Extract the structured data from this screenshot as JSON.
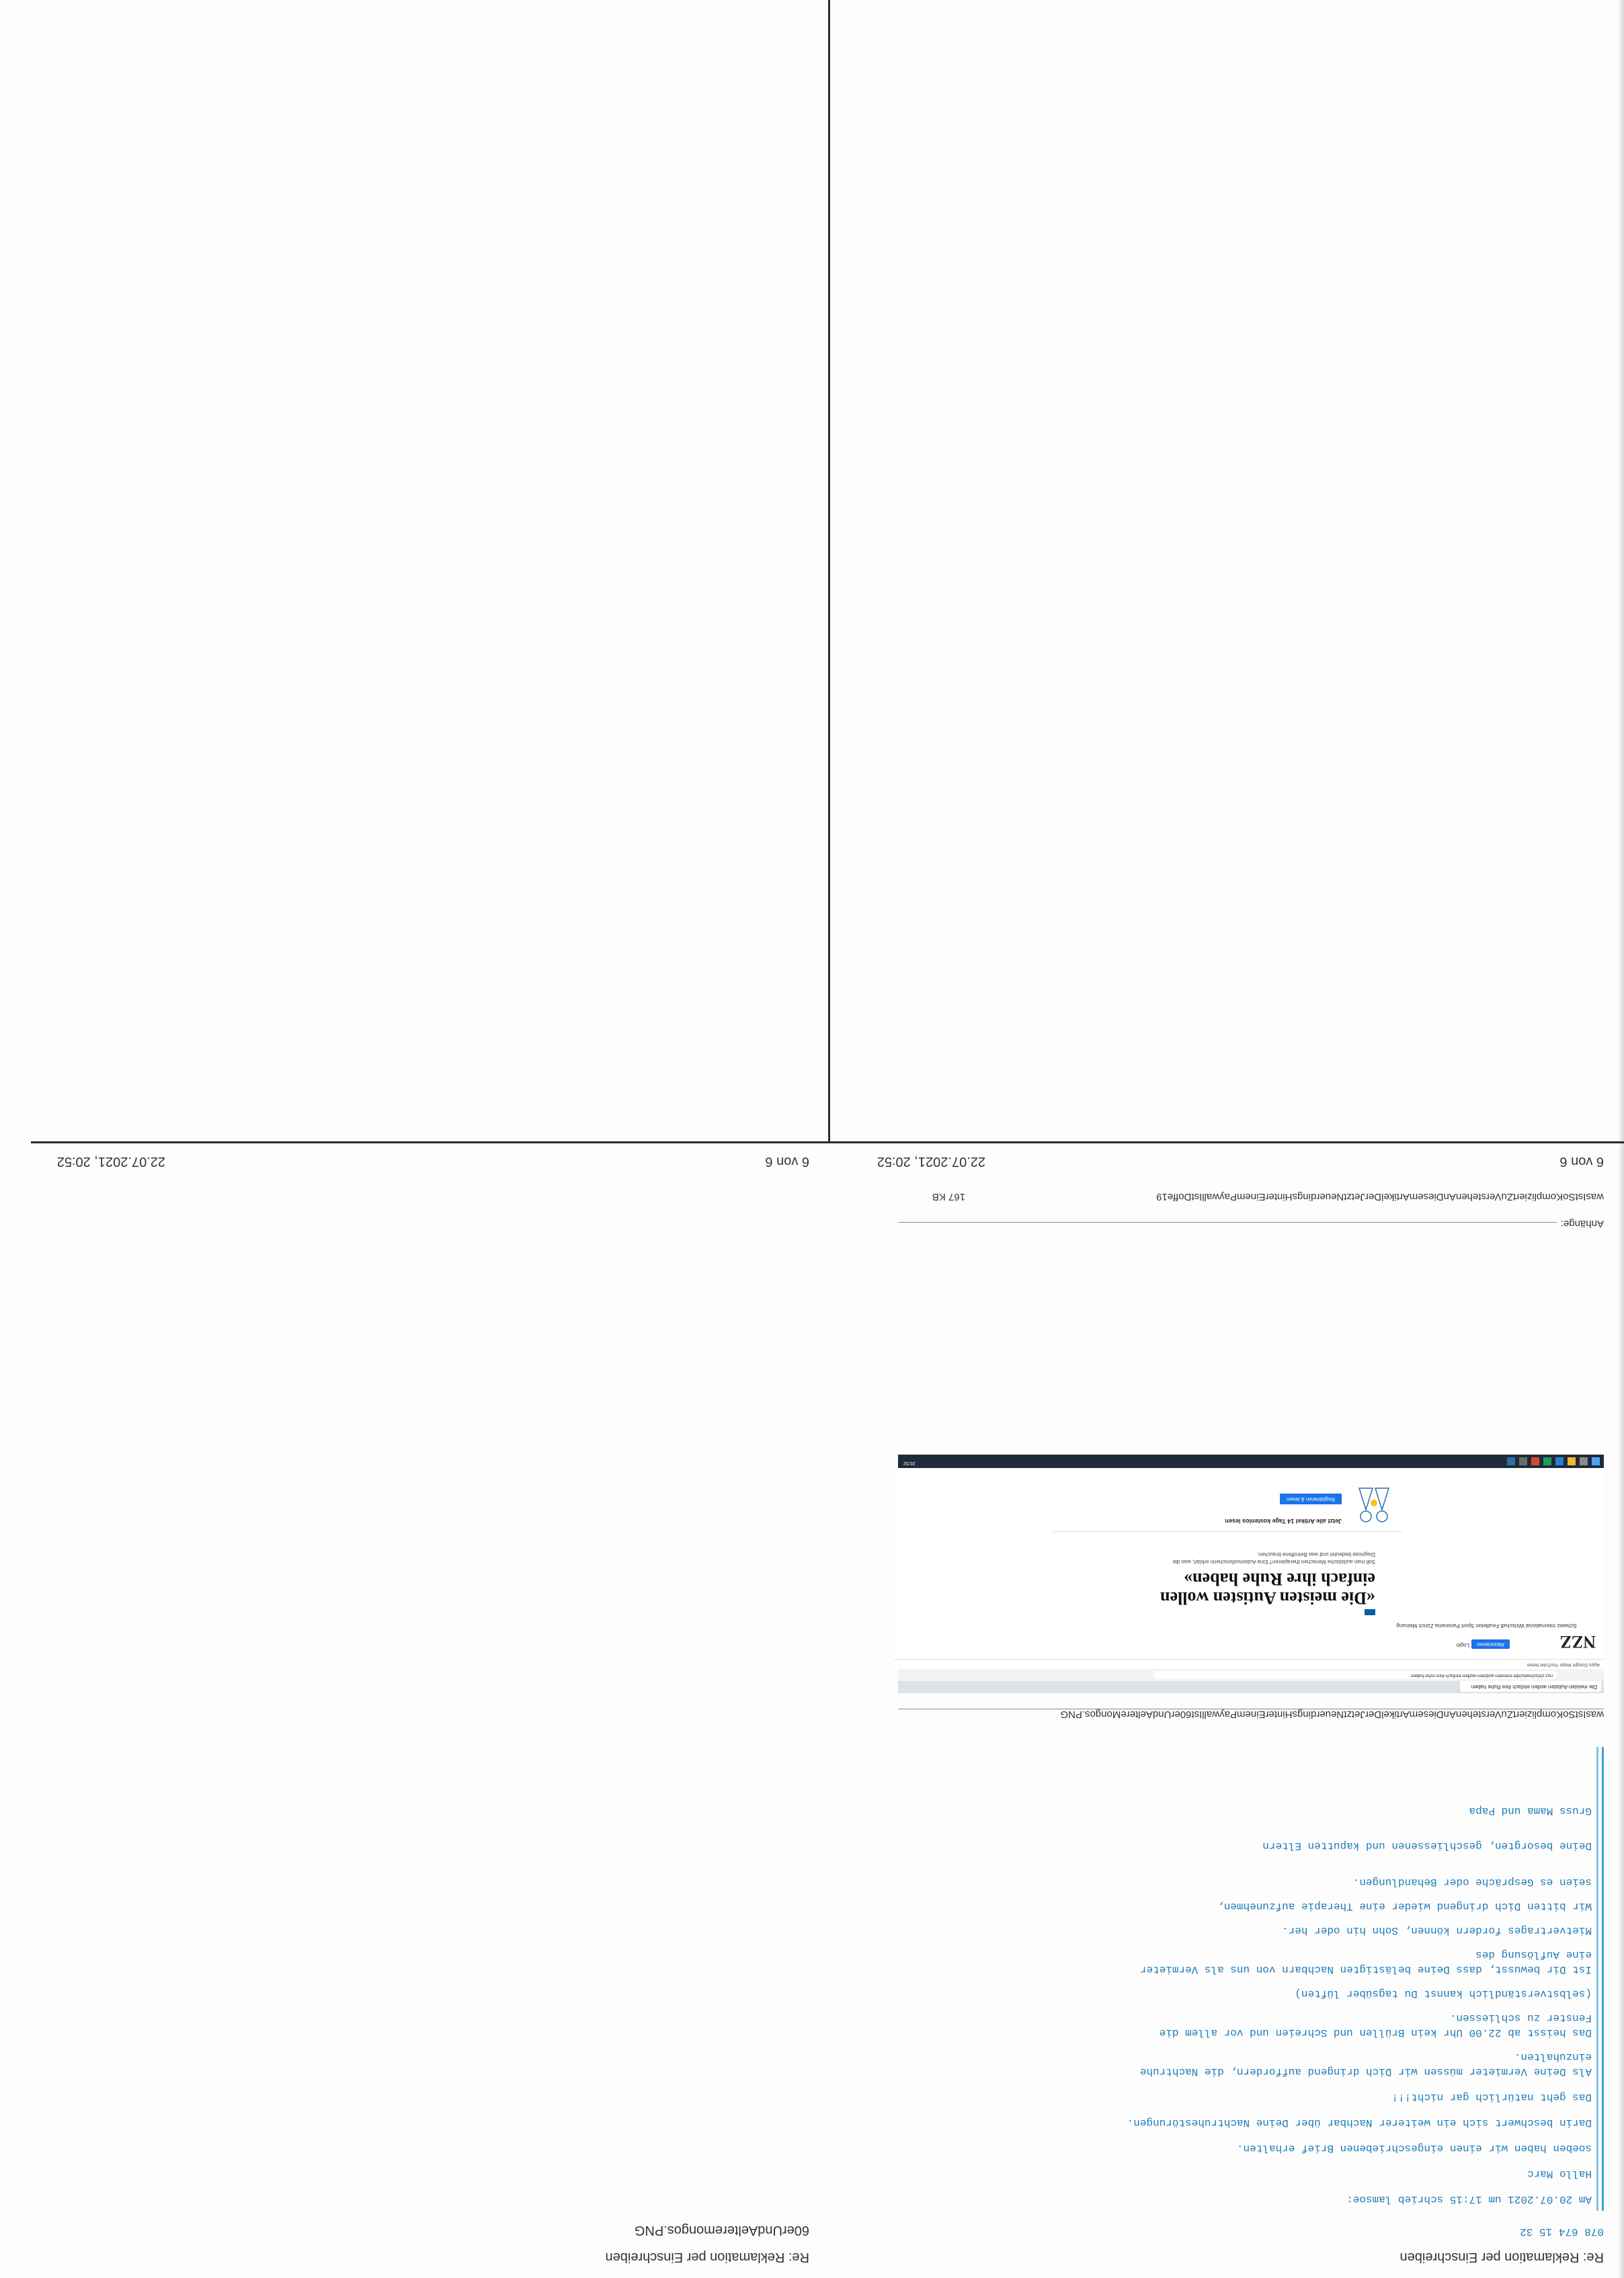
{
  "pages": {
    "right_top": {
      "header_left": "Re: Reklamation per Einschreiben",
      "attachment_name": "60erUndAelteremongos.PNG",
      "footer_page": "6 von 6",
      "footer_date": "22.07.2021, 20:52"
    },
    "left_top": {
      "header_left": "Re: Reklamation per Einschreiben",
      "phone": "078 674 15 32",
      "email_lines": [
        "Am 20.07.2021 um 17:15 schrieb lamsoe:",
        "Hallo Marc",
        "soeben haben wir einen eingeschriebenen Brief erhalten.",
        "Darin beschwert sich ein weiterer Nachbar über Deine Nachtruhestörungen.",
        "Das geht natürlich gar nicht!!!",
        "Als Deine Vermieter müssen wir Dich dringend auffordern, die Nachtruhe",
        "einzuhalten.",
        "Das heisst ab 22.00 Uhr kein Brüllen und Schreien und vor allem die",
        "Fenster zu schliessen.",
        "(selbstverständlich kannst Du tagsüber lüften)",
        "Ist Dir bewusst, dass Deine belästigten Nachbarn von uns als Vermieter",
        "eine Auflösung des",
        "Mietvertrages fordern können, Sohn hin oder her.",
        "Wir bitten Dich dringend  wieder eine Therapie aufzunehmen,",
        "seien es Gespräche oder Behandlungen.",
        "Deine besorgten, geschliessenen und kaputten Eltern",
        "Gruss Mama und Papa"
      ],
      "attachment1_name": "wasIstSoKompliziertZuVerstehenAnDiesemArtikelDerJetztNeuerdingsHinterEinemPaywallIst60erUndAeltereMongos.PNG",
      "attachments_label": "Anhänge:",
      "attachment2_name": "wasIstSoKompliziertZuVerstehenAnDiesemArtikelDerJetztNeuerdingsHinterEinemPaywallIstDoffe19",
      "attachment2_size": "167 KB",
      "footer_page": "6 von 6",
      "footer_date": "22.07.2021, 20:52"
    }
  },
  "screenshot": {
    "tab": "Die meisten Autisten wollen einfach ihre Ruhe haben",
    "url": "nzz.ch/schweiz/die-meisten-autisten-wollen-einfach-ihre-ruhe-haben",
    "bookmarks": "Apps   Google Maps   YouTube   News",
    "logo": "NZZ",
    "abo_button": "Abonnieren",
    "login": "Login",
    "nav": "Schweiz   International   Wirtschaft   Feuilleton   Sport   Panorama   Zürich   Meinung",
    "headline": "«Die meisten Autisten wollen einfach ihre Ruhe haben»",
    "lead": "Soll man autistische Menschen therapieren? Eine Autismusforscherin erklärt, was die Diagnose bedeutet und was Betroffene brauchen.",
    "promo_title": "Jetzt alle Artikel 14 Tage kostenlos lesen",
    "promo_button": "Registrieren & lesen",
    "clock": "20:52"
  }
}
